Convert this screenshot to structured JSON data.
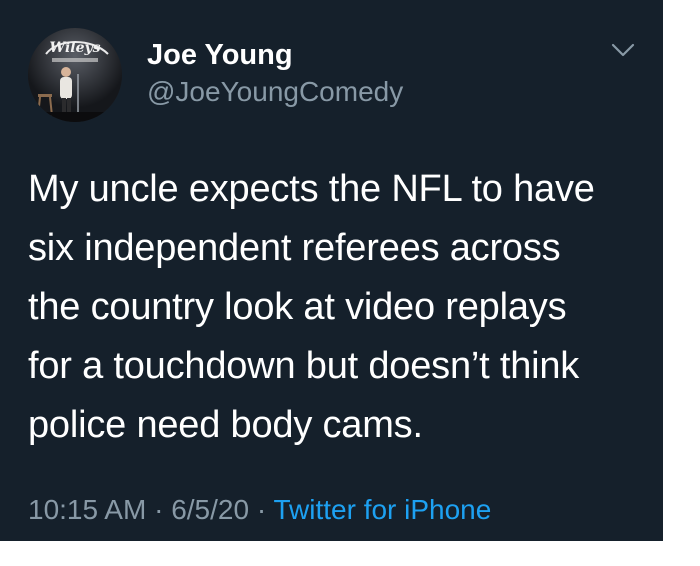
{
  "tweet": {
    "avatar_sign_text": "Wileys",
    "display_name": "Joe Young",
    "handle": "@JoeYoungComedy",
    "text_lines": [
      "My uncle expects the NFL to have",
      "six independent referees across",
      "the country look at video replays",
      "for a touchdown but doesn’t think",
      "police need body cams."
    ],
    "time": "10:15 AM",
    "date": "6/5/20",
    "separator": " · ",
    "source": "Twitter for iPhone",
    "menu_icon": "chevron-down-icon"
  },
  "colors": {
    "background": "#15202b",
    "text": "#ffffff",
    "secondary": "#8899a6",
    "link": "#1da1f2"
  }
}
